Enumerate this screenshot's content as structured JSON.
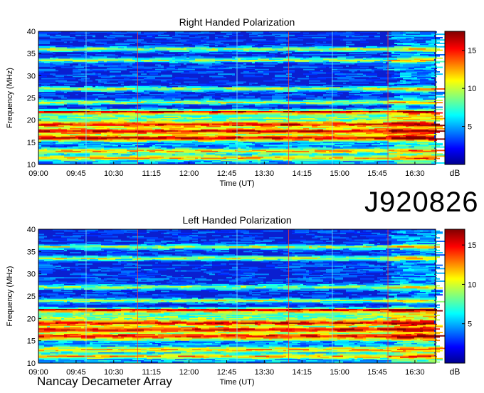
{
  "chart_data": [
    {
      "type": "heatmap",
      "title": "Right Handed Polarization",
      "xlabel": "Time (UT)",
      "ylabel": "Frequency (MHz)",
      "x_ticks": [
        "09:00",
        "09:45",
        "10:30",
        "11:15",
        "12:00",
        "12:45",
        "13:30",
        "14:15",
        "15:00",
        "15:45",
        "16:30"
      ],
      "y_ticks": [
        10,
        15,
        20,
        25,
        30,
        35,
        40
      ],
      "ylim": [
        10,
        40
      ],
      "colorbar": {
        "label": "dB",
        "ticks": [
          5,
          10,
          15
        ],
        "range": [
          0,
          17.5
        ]
      },
      "colormap": "jet",
      "bright_bands_mhz": [
        36,
        33.5,
        27,
        24,
        22,
        19,
        17.5,
        16,
        13,
        11.5
      ]
    },
    {
      "type": "heatmap",
      "title": "Left Handed Polarization",
      "xlabel": "Time (UT)",
      "ylabel": "Frequency (MHz)",
      "x_ticks": [
        "09:00",
        "09:45",
        "10:30",
        "11:15",
        "12:00",
        "12:45",
        "13:30",
        "14:15",
        "15:00",
        "15:45",
        "16:30"
      ],
      "y_ticks": [
        10,
        15,
        20,
        25,
        30,
        35,
        40
      ],
      "ylim": [
        10,
        40
      ],
      "colorbar": {
        "label": "dB",
        "ticks": [
          5,
          10,
          15
        ],
        "range": [
          0,
          17
        ]
      },
      "colormap": "jet",
      "bright_bands_mhz": [
        36,
        33.5,
        27,
        24,
        22,
        19,
        17.5,
        16,
        13,
        11.5
      ]
    }
  ],
  "observation_id": "J920826",
  "instrument": "Nancay Decameter Array"
}
